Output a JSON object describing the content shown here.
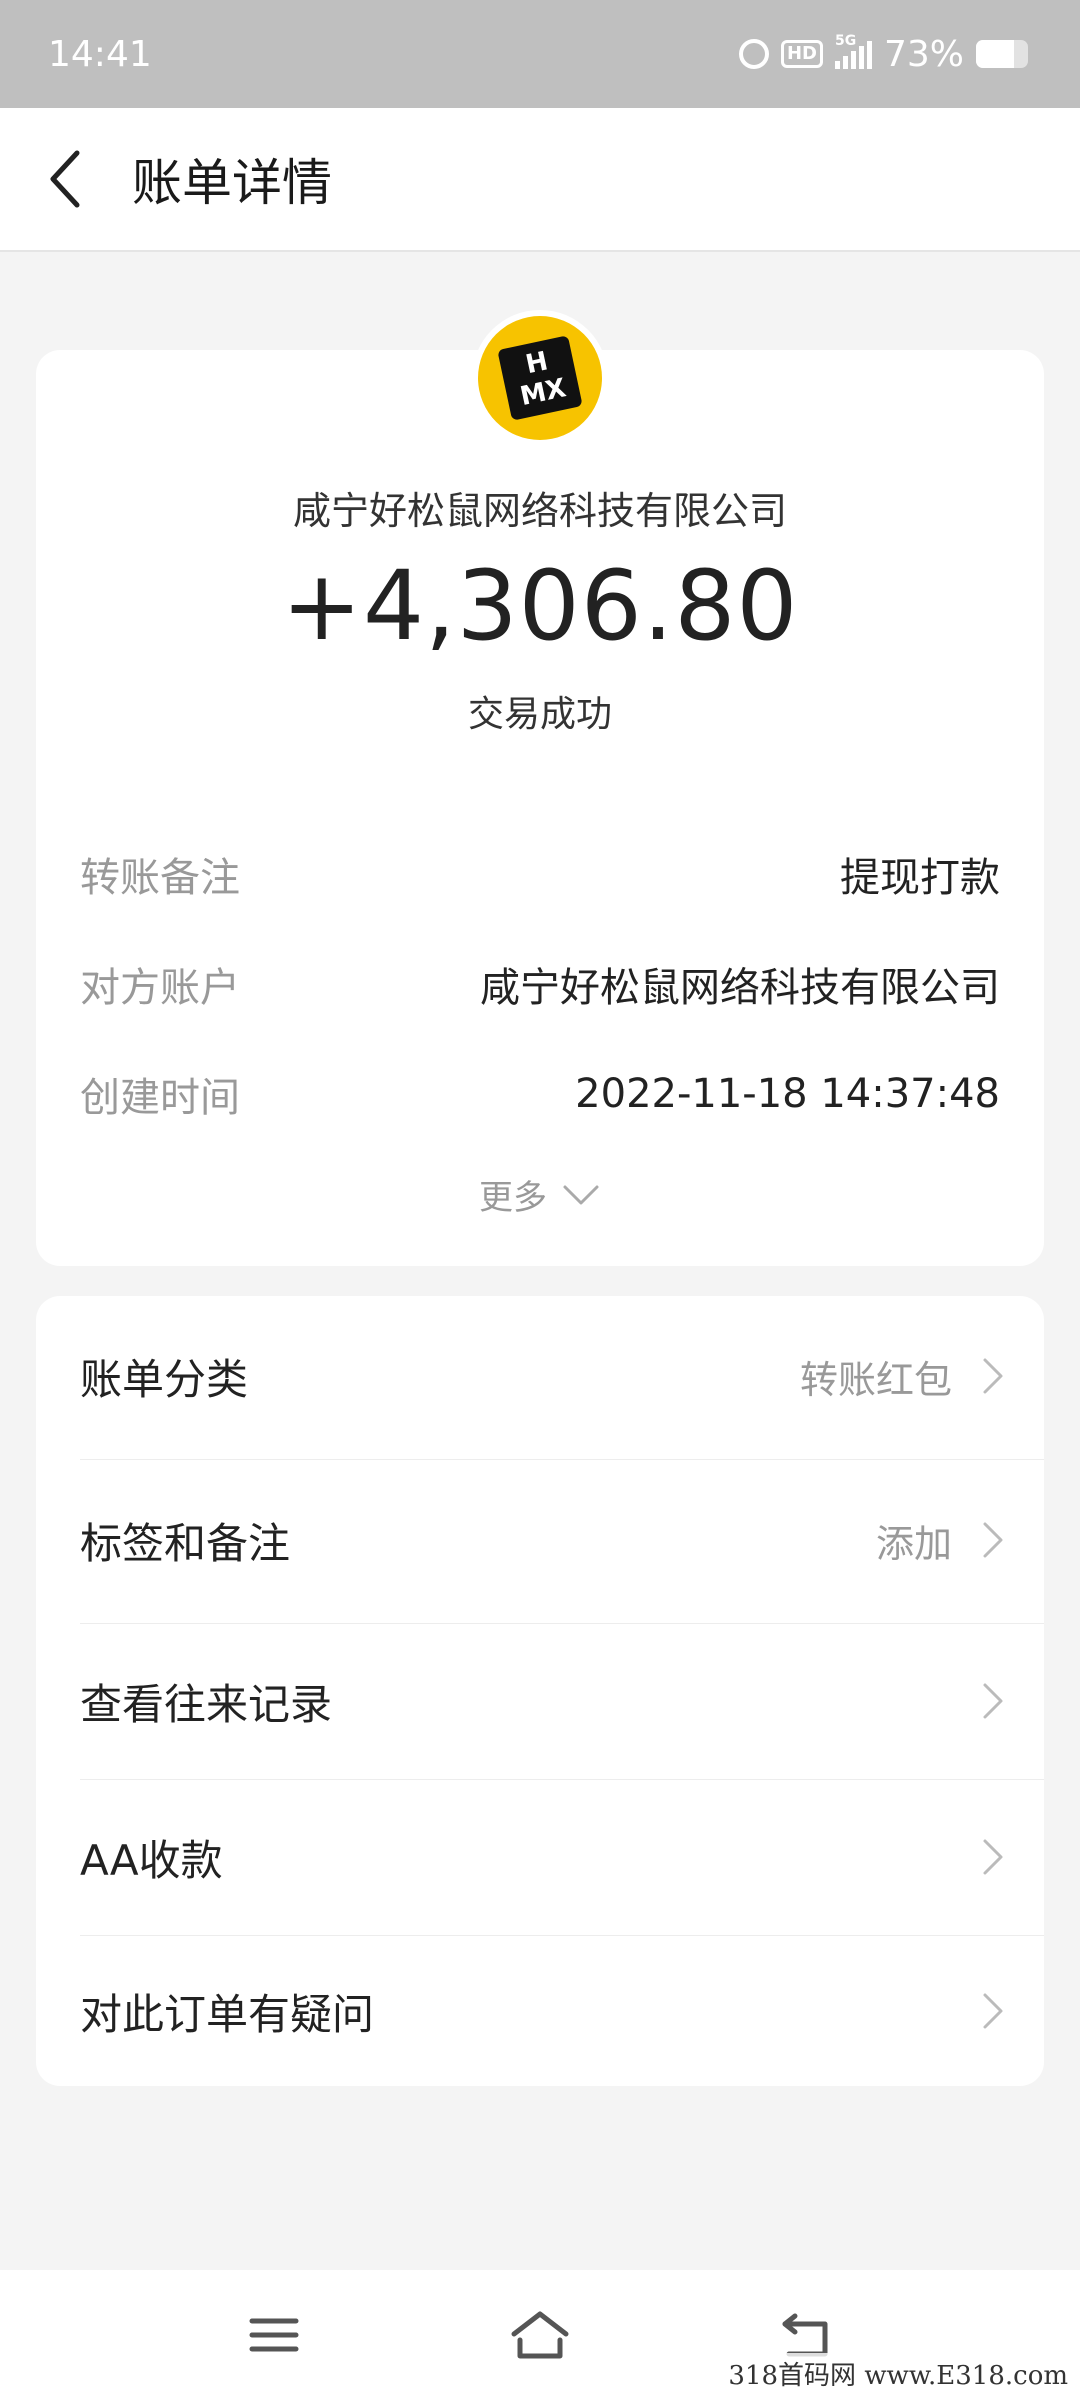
{
  "status_bar": {
    "time": "14:41",
    "hd_label": "HD",
    "network_label": "5G",
    "battery_text": "73%",
    "battery_level": 0.73,
    "icons": [
      "alarm-icon",
      "hd-icon",
      "signal-icon",
      "battery-icon"
    ]
  },
  "header": {
    "title": "账单详情",
    "back_icon": "chevron-left-icon"
  },
  "transaction": {
    "logo_text_top": "H",
    "logo_text_bottom": "MX",
    "payee": "咸宁好松鼠网络科技有限公司",
    "amount": "+4,306.80",
    "status": "交易成功",
    "details": [
      {
        "label": "转账备注",
        "value": "提现打款"
      },
      {
        "label": "对方账户",
        "value": "咸宁好松鼠网络科技有限公司"
      },
      {
        "label": "创建时间",
        "value": "2022-11-18 14:37:48"
      }
    ],
    "more_label": "更多"
  },
  "actions": [
    {
      "label": "账单分类",
      "value": "转账红包"
    },
    {
      "label": "标签和备注",
      "value": "添加"
    },
    {
      "label": "查看往来记录",
      "value": ""
    },
    {
      "label": "AA收款",
      "value": ""
    },
    {
      "label": "对此订单有疑问",
      "value": ""
    }
  ],
  "nav_bar": {
    "icons": [
      "menu-icon",
      "home-icon",
      "back-icon"
    ]
  },
  "watermark": "318首码网 www.E318.com",
  "colors": {
    "status_bar_bg": "#bfbfbf",
    "page_bg": "#f4f4f4",
    "card_bg": "#ffffff",
    "logo_bg": "#f7c300",
    "secondary_text": "#999999"
  }
}
